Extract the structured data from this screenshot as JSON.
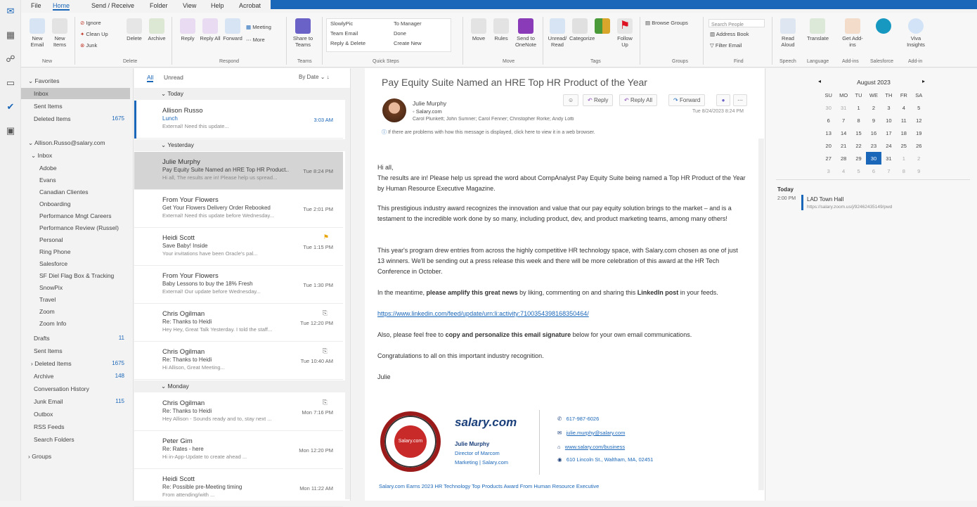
{
  "titlebar": {
    "tabs": [
      "File",
      "Home",
      "Send / Receive",
      "Folder",
      "View",
      "Help",
      "Acrobat"
    ],
    "active_tab": "Home"
  },
  "ribbon": {
    "new": {
      "new_email": "New Email",
      "new_items": "New Items"
    },
    "delete_group": {
      "ignore": "Ignore",
      "clean_up": "Clean Up",
      "junk": "Junk",
      "delete": "Delete",
      "archive": "Archive",
      "label": "Delete"
    },
    "respond": {
      "reply": "Reply",
      "reply_all": "Reply All",
      "forward": "Forward",
      "meeting": "Meeting",
      "more": "More",
      "label": "Respond"
    },
    "teams": {
      "share_to_teams": "Share to Teams",
      "label": "Teams"
    },
    "quick_steps": {
      "items": [
        "SlowlyPic",
        "Team Email",
        "Reply & Delete",
        "To Manager",
        "Done",
        "Create New"
      ],
      "label": "Quick Steps"
    },
    "move": {
      "move": "Move",
      "rules": "Rules",
      "onenote": "Send to OneNote",
      "label": "Move"
    },
    "tags": {
      "unread_read": "Unread/ Read",
      "follow_up": "Follow Up",
      "categorize": "Categorize",
      "label": "Tags"
    },
    "groups": {
      "browse_groups": "Browse Groups",
      "label": "Groups"
    },
    "find": {
      "search_people": "Search People",
      "address_book": "Address Book",
      "filter_email": "Filter Email",
      "label": "Find"
    },
    "speech": {
      "read_aloud": "Read Aloud",
      "label": "Speech"
    },
    "language": {
      "translate": "Translate",
      "label": "Language"
    },
    "addins": {
      "get_addins": "Get Add-ins",
      "label": "Add-ins"
    },
    "salesforce": {
      "label": "Salesforce"
    },
    "viva": {
      "viva_insights": "Viva Insights",
      "label": "Add-in"
    }
  },
  "folders": {
    "favorites_header": "Favorites",
    "favorites": [
      {
        "label": "Inbox",
        "count": "",
        "selected": true
      },
      {
        "label": "Sent Items",
        "count": ""
      },
      {
        "label": "Deleted Items",
        "count": "1675"
      }
    ],
    "account": "Allison.Russo@salary.com",
    "inbox_header": "Inbox",
    "subfolders": [
      "Adobe",
      "Evans",
      "Canadian Clientes",
      "Onboarding",
      "Performance Mngt Careers",
      "Performance Review (Russel)",
      "Personal",
      "Ring Phone",
      "Salesforce",
      "SF Diel Flag Box & Tracking",
      "SnowPix",
      "Travel",
      "Zoom",
      "Zoom Info"
    ],
    "drafts": {
      "label": "Drafts",
      "count": "11"
    },
    "sent_items": "Sent Items",
    "deleted": {
      "label": "Deleted Items",
      "count": "1675"
    },
    "archive": {
      "label": "Archive",
      "count": "148"
    },
    "conversation_history": "Conversation History",
    "junk": {
      "label": "Junk Email",
      "count": "115"
    },
    "outbox": "Outbox",
    "rss": "RSS Feeds",
    "search_folders": "Search Folders",
    "groups_header": "Groups"
  },
  "message_list": {
    "filter_all": "All",
    "filter_unread": "Unread",
    "sort": "By Date",
    "groups": [
      {
        "header": "Today",
        "messages": [
          {
            "from": "Allison Russo",
            "subject": "Lunch",
            "preview": "External! Need this update...",
            "date": "3:03 AM",
            "unread": true
          }
        ]
      },
      {
        "header": "Yesterday",
        "messages": [
          {
            "from": "Julie Murphy",
            "subject": "Pay Equity Suite Named an HRE Top HR Product...",
            "preview": "Hi all, The results are in! Please help us spread...",
            "date": "Tue 8:24 PM",
            "selected": true
          },
          {
            "from": "From Your Flowers",
            "subject": "Get Your Flowers Delivery Order Rebooked",
            "preview": "External! Need this update before Wednesday...",
            "date": "Tue 2:01 PM"
          },
          {
            "from": "Heidi Scott",
            "subject": "Save Baby! Inside",
            "preview": "Your invitations have been Oracle's pal...",
            "date": "Tue 1:15 PM"
          },
          {
            "from": "From Your Flowers",
            "subject": "Baby Lessons to buy the 18% Fresh",
            "preview": "External! Our update before Wednesday...",
            "date": "Tue 1:30 PM"
          },
          {
            "from": "Chris Ogilman",
            "subject": "Re: Thanks to Heidi",
            "preview": "Hey Hey, Great Talk Yesterday. I told the staff...",
            "date": "Tue 12:20 PM"
          },
          {
            "from": "Chris Ogilman",
            "subject": "Re: Thanks to Heidi",
            "preview": "Hi Allison, Great Meeting...",
            "date": "Tue 10:40 AM"
          }
        ]
      },
      {
        "header": "Monday",
        "messages": [
          {
            "from": "Chris Ogilman",
            "subject": "Re: Thanks to Heidi",
            "preview": "Hey Allison - Sounds ready and to, stay next ...",
            "date": "Mon 7:16 PM"
          },
          {
            "from": "Peter Gim",
            "subject": "Re: Rates - here",
            "preview": "Hi in-App-Update to create ahead ...",
            "date": "Mon 12:20 PM"
          },
          {
            "from": "Heidi Scott",
            "subject": "Re: Possible pre-Meeting timing",
            "preview": "From attending/with ...",
            "date": "Mon 11:22 AM"
          }
        ]
      }
    ]
  },
  "reading": {
    "subject": "Pay Equity Suite Named an HRE Top HR Product of the Year",
    "sender": "Julie Murphy",
    "sender_tag": "Salary.com",
    "to": "Carol Plunkett; John Sumner; Carol Fenner; Christopher Rorke; Andy Lotti",
    "timestamp": "Tue 8/24/2023 8:24 PM",
    "info_bar": "If there are problems with how this message is displayed, click here to view it in a web browser.",
    "actions": {
      "reply": "Reply",
      "reply_all": "Reply All",
      "forward": "Forward"
    },
    "body": {
      "greeting": "Hi all,",
      "p1": "The results are in! Please help us spread the word about CompAnalyst Pay Equity Suite being named a Top HR Product of the Year by Human Resource Executive Magazine.",
      "p2": "This prestigious industry award recognizes the innovation and value that our pay equity solution brings to the market – and is a testament to the incredible work done by so many, including product, dev, and product marketing teams, among many others!",
      "p3": "This year's program drew entries from across the highly competitive HR technology space, with Salary.com chosen as one of just 13 winners. We'll be sending out a press release this week and there will be more celebration of this award at the HR Tech Conference in October.",
      "p4_pre": "In the meantime, ",
      "p4_b1": "please amplify this great news",
      "p4_mid": " by liking, commenting on and sharing this ",
      "p4_b2": "LinkedIn post",
      "p4_post": " in your feeds.",
      "link": "https://www.linkedin.com/feed/update/urn:li:activity:7100354398168350464/",
      "p5_pre": "Also, please feel free to ",
      "p5_b": "copy and personalize this email signature",
      "p5_post": " below for your own email communications.",
      "p6": "Congratulations to all on this important industry recognition.",
      "signoff": "Julie"
    },
    "signature": {
      "logo": "salary.com",
      "name": "Julie Murphy",
      "title": "Director of Marcom",
      "company": "Marketing | Salary.com",
      "phone": "617-987-6026",
      "email": "julie.murphy@salary.com",
      "web": "www.salary.com/business",
      "address": "610 Lincoln St., Waltham, MA, 02451",
      "seal_text": "Salary.com",
      "footer": "Salary.com Earns 2023 HR Technology Top Products Award From Human Resource Executive"
    }
  },
  "calendar": {
    "month": "August 2023",
    "weekdays": [
      "SU",
      "MO",
      "TU",
      "WE",
      "TH",
      "FR",
      "SA"
    ],
    "weeks": [
      [
        "30",
        "31",
        "1",
        "2",
        "3",
        "4",
        "5"
      ],
      [
        "6",
        "7",
        "8",
        "9",
        "10",
        "11",
        "12"
      ],
      [
        "13",
        "14",
        "15",
        "16",
        "17",
        "18",
        "19"
      ],
      [
        "20",
        "21",
        "22",
        "23",
        "24",
        "25",
        "26"
      ],
      [
        "27",
        "28",
        "29",
        "30",
        "31",
        "1",
        "2"
      ],
      [
        "3",
        "4",
        "5",
        "6",
        "7",
        "8",
        "9"
      ]
    ],
    "today": "30",
    "today_label": "Today",
    "event_time": "2:00 PM",
    "event_title": "LAD Town Hall",
    "event_sub": "https://salary.zoom.us/j/92462435149/pwd"
  },
  "colors": {
    "accent": "#1a66b8",
    "selected_row": "#d4d4d4"
  }
}
